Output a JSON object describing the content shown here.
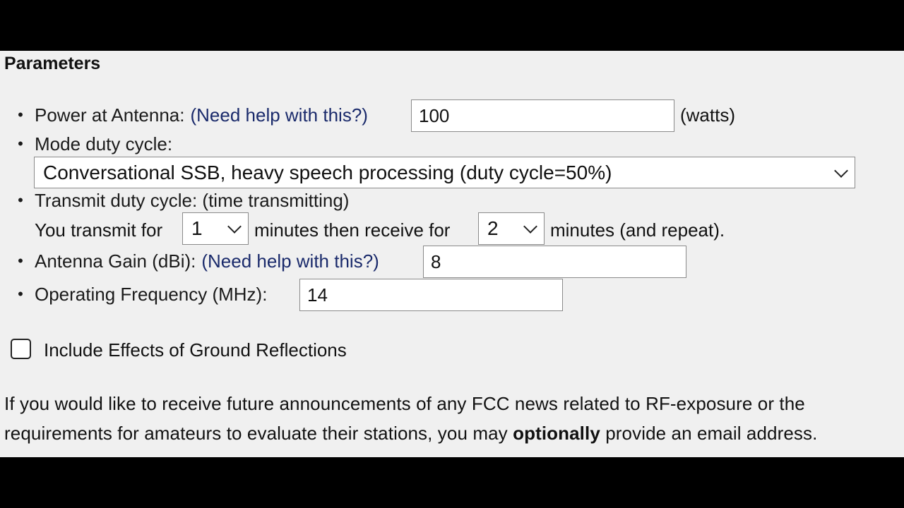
{
  "section": {
    "title": "Parameters"
  },
  "power": {
    "label": "Power at Antenna:",
    "help": "(Need help with this?)",
    "value": "100",
    "unit": "(watts)"
  },
  "mode": {
    "label": "Mode duty cycle:",
    "selected": "Conversational SSB, heavy speech processing (duty cycle=50%)"
  },
  "transmit": {
    "label": "Transmit duty cycle: (time transmitting)",
    "prefix": "You transmit for",
    "transmit_minutes": "1",
    "middle": "minutes then receive for",
    "receive_minutes": "2",
    "suffix": "minutes (and repeat)."
  },
  "gain": {
    "label": "Antenna Gain (dBi):",
    "help": "(Need help with this?)",
    "value": "8"
  },
  "frequency": {
    "label": "Operating Frequency (MHz):",
    "value": "14"
  },
  "ground": {
    "label": "Include Effects of Ground Reflections",
    "checked": false
  },
  "notice": {
    "before": "If you would like to receive future announcements of any FCC news related to RF-exposure or the requirements for amateurs to evaluate their stations, you may ",
    "emphasis": "optionally",
    "after": " provide an email address."
  }
}
